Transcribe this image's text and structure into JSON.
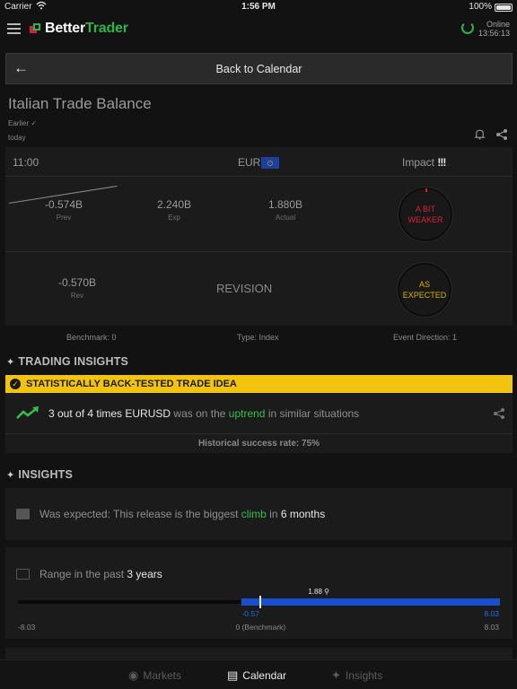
{
  "status_bar": {
    "carrier": "Carrier",
    "time": "1:56 PM",
    "battery": "100%"
  },
  "header": {
    "brand_better": "Better",
    "brand_trader": "Trader",
    "online_label": "Online",
    "online_time": "13:56:13"
  },
  "back_bar": {
    "label": "Back to Calendar"
  },
  "event": {
    "title": "Italian Trade Balance",
    "earlier": "Earlier ✓",
    "day": "today",
    "time": "11:00",
    "currency": "EUR",
    "impact_label": "Impact",
    "impact_marks": "!!!",
    "prev_value": "-0.574B",
    "prev_label": "Prev",
    "exp_value": "2.240B",
    "exp_label": "Exp",
    "actual_value": "1.880B",
    "actual_label": "Actual",
    "actual_gauge": "A BIT\nWEAKER",
    "rev_value": "-0.570B",
    "rev_label": "Rev",
    "revision_label": "REVISION",
    "rev_gauge": "AS\nEXPECTED",
    "benchmark": "Benchmark: 0",
    "type": "Type: Index",
    "direction": "Event Direction: 1"
  },
  "trading_insights": {
    "title": "TRADING INSIGHTS",
    "banner": "STATISTICALLY BACK-TESTED TRADE IDEA",
    "part1": "3 out of 4 times EURUSD",
    "part2": " was on the ",
    "part3": "uptrend",
    "part4": " in similar situations",
    "success_rate": "Historical success rate: 75%"
  },
  "insights": {
    "title": "INSIGHTS",
    "card1_a": "Was expected: This release is the biggest ",
    "card1_b": "climb",
    "card1_c": " in ",
    "card1_d": "6 months",
    "card2_a": "Range in the past ",
    "card2_b": "3 years",
    "range": {
      "min": -8.03,
      "max": 8.03,
      "current": 1.88,
      "prev": -0.57,
      "benchmark": 0,
      "current_label": "1.88",
      "prev_label": "-0.57",
      "fill_end_label": "8.03",
      "min_label": "-8.03",
      "max_label": "8.03",
      "benchmark_label": "0 (Benchmark)"
    }
  },
  "tabs": [
    {
      "label": "Markets",
      "icon": "globe-icon",
      "active": false
    },
    {
      "label": "Calendar",
      "icon": "calendar-icon",
      "active": true
    },
    {
      "label": "Insights",
      "icon": "wand-icon",
      "active": false
    }
  ],
  "colors": {
    "accent_green": "#35c04c",
    "brand_red": "#d6213a",
    "banner_yellow": "#f2c40f",
    "range_blue": "#1a4ed1",
    "expected_yellow": "#d4b300"
  }
}
